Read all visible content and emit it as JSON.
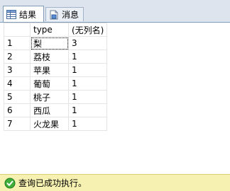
{
  "tabs": [
    {
      "label": "结果",
      "icon": "grid-icon",
      "active": true
    },
    {
      "label": "消息",
      "icon": "message-icon",
      "active": false
    }
  ],
  "grid": {
    "columns": [
      "type",
      "(无列名)"
    ],
    "rows": [
      {
        "num": "1",
        "type": "梨",
        "count": "3"
      },
      {
        "num": "2",
        "type": "荔枝",
        "count": "1"
      },
      {
        "num": "3",
        "type": "苹果",
        "count": "1"
      },
      {
        "num": "4",
        "type": "葡萄",
        "count": "1"
      },
      {
        "num": "5",
        "type": "桃子",
        "count": "1"
      },
      {
        "num": "6",
        "type": "西瓜",
        "count": "1"
      },
      {
        "num": "7",
        "type": "火龙果",
        "count": "1"
      }
    ]
  },
  "status": {
    "text": "查询已成功执行。",
    "icon": "success-check-icon",
    "color": "#f6f1b0"
  }
}
